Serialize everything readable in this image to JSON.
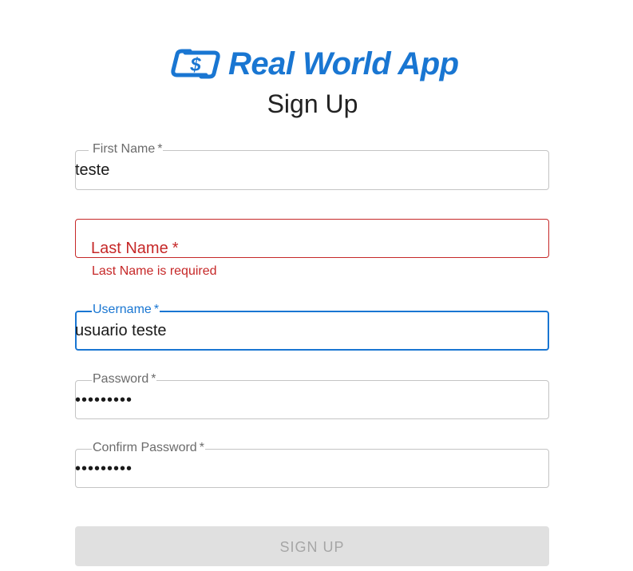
{
  "brand": {
    "logo_icon": "dollar-card-icon",
    "name": "Real World App",
    "color": "#1976d2"
  },
  "title": "Sign Up",
  "form": {
    "first_name": {
      "label": "First Name",
      "required_mark": "*",
      "value": "teste"
    },
    "last_name": {
      "label": "Last Name",
      "required_mark": "*",
      "value": "",
      "error": "Last Name is required",
      "error_color": "#c62828"
    },
    "username": {
      "label": "Username",
      "required_mark": "*",
      "value": "usuario teste",
      "focused": true
    },
    "password": {
      "label": "Password",
      "required_mark": "*",
      "value": "•••••••••"
    },
    "confirm_password": {
      "label": "Confirm Password",
      "required_mark": "*",
      "value": "•••••••••"
    }
  },
  "submit": {
    "label": "SIGN UP",
    "disabled": true
  }
}
